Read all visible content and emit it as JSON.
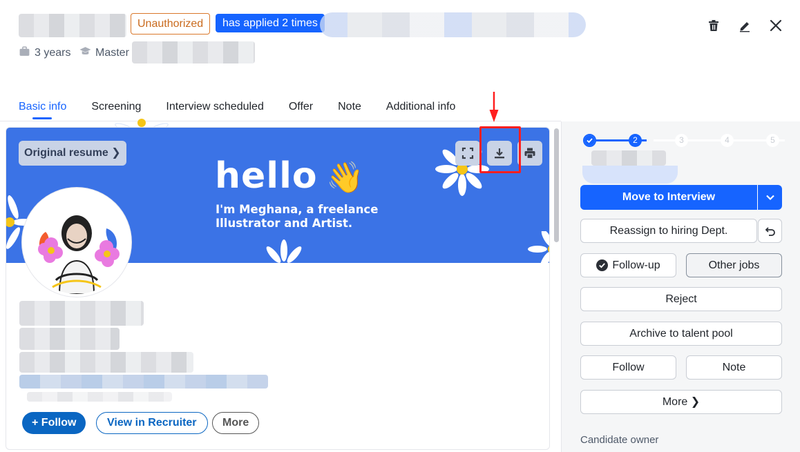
{
  "header": {
    "badge_unauthorized": "Unauthorized",
    "badge_applied": "has applied 2 times",
    "experience": "3 years",
    "degree": "Master"
  },
  "tabs": [
    {
      "label": "Basic info",
      "active": true
    },
    {
      "label": "Screening"
    },
    {
      "label": "Interview scheduled"
    },
    {
      "label": "Offer"
    },
    {
      "label": "Note"
    },
    {
      "label": "Additional info"
    }
  ],
  "resume": {
    "original_resume_label": "Original resume ❯",
    "banner_hello": "hello",
    "banner_tagline_line1": "I'm Meghana, a freelance",
    "banner_tagline_line2": "Illustrator and Artist.",
    "follow_label": "+ Follow",
    "view_in_recruiter_label": "View in Recruiter",
    "more_label": "More"
  },
  "pipeline": {
    "steps": [
      "1",
      "2",
      "3",
      "4",
      "5"
    ],
    "current_step": 2,
    "primary_action": "Move to Interview",
    "reassign_label": "Reassign to hiring Dept.",
    "follow_up_label": "Follow-up",
    "other_jobs_label": "Other jobs",
    "reject_label": "Reject",
    "archive_label": "Archive to talent pool",
    "follow_label": "Follow",
    "note_label": "Note",
    "more_label": "More ❯",
    "candidate_owner_label": "Candidate owner"
  },
  "colors": {
    "accent": "#1664ff",
    "banner": "#3b73e6",
    "unauthorized": "#d9772a",
    "linkedin_blue": "#0a66c2",
    "highlight": "#ff1f1f"
  }
}
